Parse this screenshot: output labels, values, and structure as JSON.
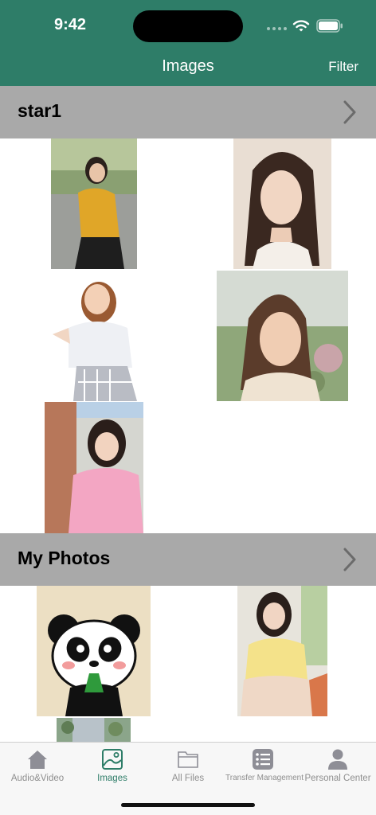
{
  "status_bar": {
    "time": "9:42"
  },
  "nav": {
    "title": "Images",
    "filter_label": "Filter"
  },
  "sections": [
    {
      "title": "star1",
      "photos": [
        "photo-yellow-shirt",
        "photo-portrait-long-hair",
        "photo-white-shirt-plaid",
        "photo-outdoor-smile",
        "photo-pink-sweater"
      ]
    },
    {
      "title": "My Photos",
      "photos": [
        "photo-panda-cartoon",
        "photo-yellow-top-sitting",
        "photo-partial"
      ]
    }
  ],
  "tabs": [
    {
      "label": "Audio&Video",
      "icon": "home-icon",
      "active": false
    },
    {
      "label": "Images",
      "icon": "image-icon",
      "active": true
    },
    {
      "label": "All Files",
      "icon": "folder-icon",
      "active": false
    },
    {
      "label": "Transfer Management",
      "icon": "list-icon",
      "active": false
    },
    {
      "label": "Personal Center",
      "icon": "person-icon",
      "active": false
    }
  ],
  "colors": {
    "accent": "#2e7d68",
    "section_bg": "#a9a9a9",
    "tab_inactive": "#8e8e8e"
  }
}
